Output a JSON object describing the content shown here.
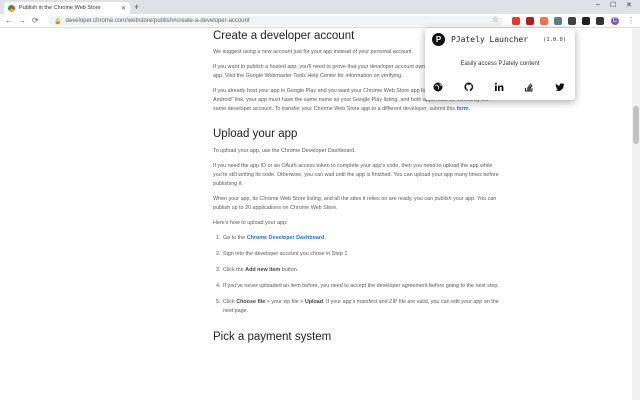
{
  "browser": {
    "tab_title": "Publish in the Chrome Web Store",
    "tab_close": "✕",
    "new_tab": "+",
    "window_controls": [
      "–",
      "☐",
      "✕"
    ],
    "nav": [
      "←",
      "→",
      "⟳"
    ],
    "lock_icon": "🔒",
    "url": "developer.chrome.com/webstore/publish#create-a-developer-account",
    "star_icon": "☆",
    "extension_colors": [
      "#e53935",
      "#b71c1c",
      "#ff7043",
      "#607d8b",
      "#424242",
      "#212121",
      "#333333"
    ],
    "profile_initial": "C",
    "profile_color": "#7e57c2",
    "menu_icon": "⋮"
  },
  "page": {
    "section1": {
      "title": "Create a developer account",
      "p1": "We suggest using a new account just for your app instead of your personal account.",
      "p2": "If you want to publish a hosted app, you'll need to prove that your developer account owns the URLs that comprise the app. Visit the Google Webmaster Tools Help Center for information on verifying.",
      "p3_a": "If you already host your app in Google Play and you want your Chrome Web Store app listing to show an \"Available for Android\" link, your app must have the same name as your Google Play listing, and both apps must be owned by the same developer account. To transfer your Chrome Web Store app to a different developer, submit this ",
      "p3_link": "form",
      "p3_b": "."
    },
    "section2": {
      "title": "Upload your app",
      "p1": "To upload your app, use the Chrome Developer Dashboard.",
      "p2": "If you need the app ID or an OAuth access token to complete your app's code, then you need to upload the app while you're still writing its code. Otherwise, you can wait until the app is finished. You can upload your app many times before publishing it.",
      "p3": "When your app, its Chrome Web Store listing, and all the sites it relies on are ready, you can publish your app. You can publish up to 20 applications on Chrome Web Store.",
      "p4": "Here's how to upload your app:",
      "steps": [
        {
          "num": "1.",
          "a": "Go to the ",
          "bold": "Chrome Developer Dashboard",
          "b": "."
        },
        {
          "num": "2.",
          "a": "Sign into the developer account you chose in Step 1.",
          "bold": "",
          "b": ""
        },
        {
          "num": "3.",
          "a": "Click the ",
          "bold": "Add new item",
          "b": " button."
        },
        {
          "num": "4.",
          "a": "If you've never uploaded an item before, you need to accept the developer agreement before going to the next step.",
          "bold": "",
          "b": ""
        },
        {
          "num": "5.",
          "a": "Click ",
          "bold": "Choose file",
          "b": ""
        }
      ],
      "step5_rest_a": " > your zip file > ",
      "step5_upload": "Upload",
      "step5_rest_b": ". If your app's manifest and ZIP file are valid, you can edit your app on the next page."
    },
    "section3": {
      "title": "Pick a payment system"
    }
  },
  "popup": {
    "logo_letter": "P",
    "name": "PJately Launcher",
    "version": "(1.0.0)",
    "tagline": "Easily access PJately content",
    "icons": [
      "globe-icon",
      "github-icon",
      "linkedin-icon",
      "stackoverflow-icon",
      "twitter-icon"
    ]
  }
}
